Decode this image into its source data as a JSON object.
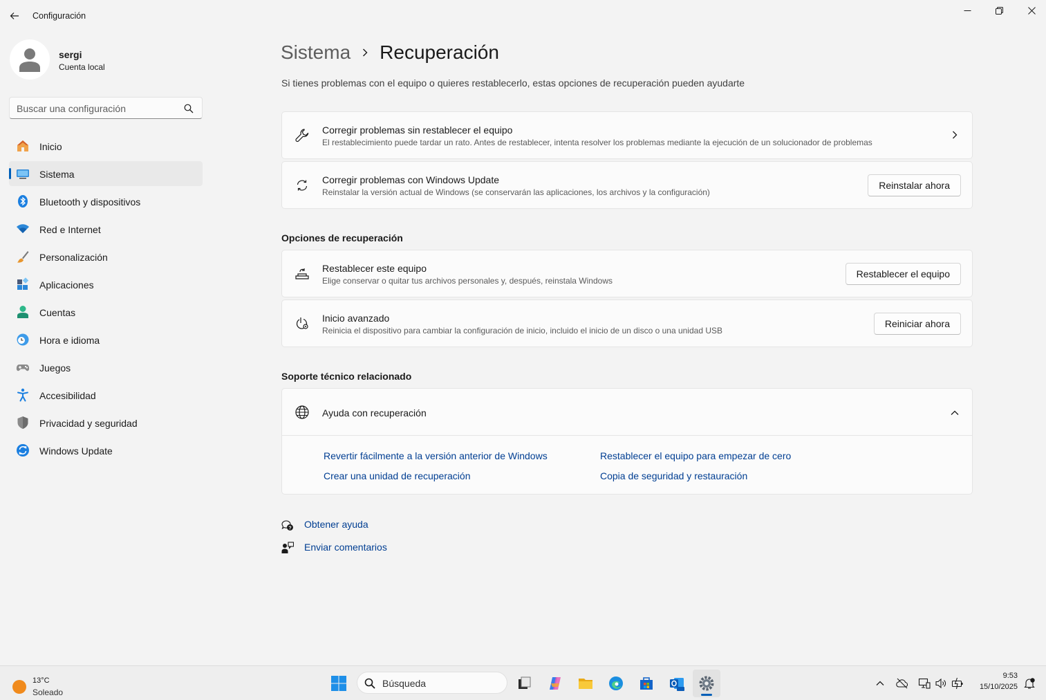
{
  "window": {
    "title": "Configuración"
  },
  "profile": {
    "name": "sergi",
    "account_type": "Cuenta local"
  },
  "search": {
    "placeholder": "Buscar una configuración"
  },
  "sidebar": {
    "items": [
      {
        "label": "Inicio",
        "icon": "home-icon"
      },
      {
        "label": "Sistema",
        "icon": "monitor-icon",
        "active": true
      },
      {
        "label": "Bluetooth y dispositivos",
        "icon": "bluetooth-icon"
      },
      {
        "label": "Red e Internet",
        "icon": "wifi-icon"
      },
      {
        "label": "Personalización",
        "icon": "brush-icon"
      },
      {
        "label": "Aplicaciones",
        "icon": "apps-icon"
      },
      {
        "label": "Cuentas",
        "icon": "person-icon"
      },
      {
        "label": "Hora e idioma",
        "icon": "clock-globe-icon"
      },
      {
        "label": "Juegos",
        "icon": "gamepad-icon"
      },
      {
        "label": "Accesibilidad",
        "icon": "accessibility-icon"
      },
      {
        "label": "Privacidad y seguridad",
        "icon": "shield-icon"
      },
      {
        "label": "Windows Update",
        "icon": "update-icon"
      }
    ]
  },
  "main": {
    "breadcrumb_parent": "Sistema",
    "breadcrumb_current": "Recuperación",
    "intro": "Si tienes problemas con el equipo o quieres restablecerlo, estas opciones de recuperación pueden ayudarte",
    "top_cards": [
      {
        "title": "Corregir problemas sin restablecer el equipo",
        "description": "El restablecimiento puede tardar un rato. Antes de restablecer, intenta resolver los problemas mediante la ejecución de un solucionador de problemas",
        "icon": "wrench-icon"
      },
      {
        "title": "Corregir problemas con Windows Update",
        "description": "Reinstalar la versión actual de Windows (se conservarán las aplicaciones, los archivos y la configuración)",
        "button": "Reinstalar ahora",
        "icon": "sync-icon"
      }
    ],
    "recovery_section": "Opciones de recuperación",
    "recovery_cards": [
      {
        "title": "Restablecer este equipo",
        "description": "Elige conservar o quitar tus archivos personales y, después, reinstala Windows",
        "button": "Restablecer el equipo",
        "icon": "reset-pc-icon"
      },
      {
        "title": "Inicio avanzado",
        "description": "Reinicia el dispositivo para cambiar la configuración de inicio, incluido el inicio de un disco o una unidad USB",
        "button": "Reiniciar ahora",
        "icon": "advanced-startup-icon"
      }
    ],
    "support_section": "Soporte técnico relacionado",
    "support": {
      "title": "Ayuda con recuperación",
      "icon": "globe-icon",
      "links": [
        "Revertir fácilmente a la versión anterior de Windows",
        "Restablecer el equipo para empezar de cero",
        "Crear una unidad de recuperación",
        "Copia de seguridad y restauración"
      ]
    },
    "footer_links": [
      {
        "label": "Obtener ayuda",
        "icon": "help-icon"
      },
      {
        "label": "Enviar comentarios",
        "icon": "feedback-icon"
      }
    ]
  },
  "taskbar": {
    "weather_temp": "13°C",
    "weather_desc": "Soleado",
    "search_label": "Búsqueda",
    "apps": [
      "start-icon",
      "task-view-icon",
      "copilot-icon",
      "file-explorer-icon",
      "edge-icon",
      "store-icon",
      "outlook-icon",
      "settings-icon"
    ],
    "time": "9:53",
    "date": "15/10/2025"
  },
  "colors": {
    "accent": "#005fb8",
    "link": "#003e92",
    "background": "#f3f3f3",
    "card": "#fbfbfb"
  }
}
